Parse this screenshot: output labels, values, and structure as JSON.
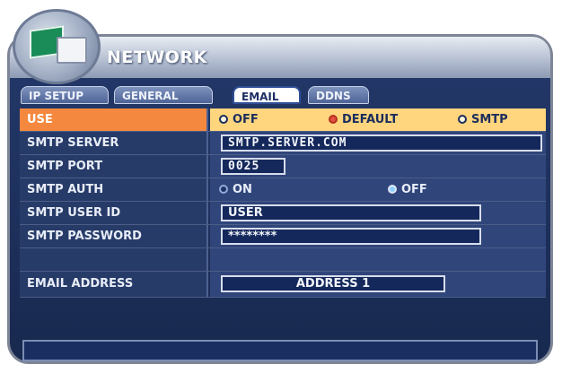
{
  "window": {
    "title": "NETWORK"
  },
  "tabs": [
    "IP SETUP",
    "GENERAL",
    "EMAIL",
    "DDNS"
  ],
  "rows": {
    "use": {
      "label": "USE",
      "options": [
        "OFF",
        "DEFAULT",
        "SMTP"
      ],
      "selected": "DEFAULT"
    },
    "smtp_server": {
      "label": "SMTP SERVER",
      "value": "SMTP.SERVER.COM"
    },
    "smtp_port": {
      "label": "SMTP PORT",
      "value": "0025"
    },
    "smtp_auth": {
      "label": "SMTP AUTH",
      "options": [
        "ON",
        "OFF"
      ],
      "selected": "OFF"
    },
    "smtp_user_id": {
      "label": "SMTP USER ID",
      "value": "USER"
    },
    "smtp_password": {
      "label": "SMTP PASSWORD",
      "value": "********"
    },
    "email_address": {
      "label": "EMAIL ADDRESS",
      "value": "ADDRESS 1"
    }
  },
  "colors": {
    "use_label": "#f4883f",
    "use_value": "#ffd57d",
    "panel": "#24396b"
  }
}
